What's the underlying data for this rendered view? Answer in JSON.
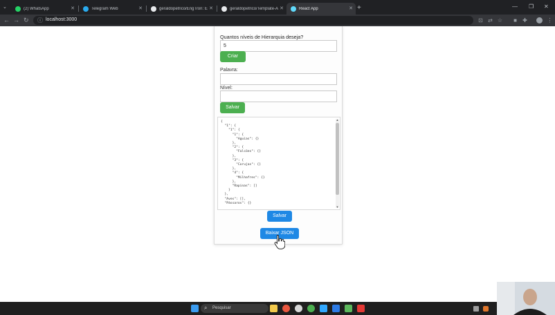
{
  "browser": {
    "tabs": [
      {
        "title": "(2) WhatsApp",
        "icon": "whatsapp-icon",
        "color": "#25d366",
        "active": false
      },
      {
        "title": "Telegram Web",
        "icon": "telegram-icon",
        "color": "#2aabee",
        "active": false
      },
      {
        "title": "geraldopetrico/EngTron: Eurla",
        "icon": "github-icon",
        "color": "#e8eaed",
        "active": false
      },
      {
        "title": "geraldopetrico/Template-Angu",
        "icon": "github-icon",
        "color": "#e8eaed",
        "active": false
      },
      {
        "title": "React App",
        "icon": "react-icon",
        "color": "#61dafb",
        "active": true
      }
    ],
    "new_tab_label": "+",
    "url": "localhost:3000"
  },
  "form": {
    "levels_label": "Quantos níveis de Hierarquia deseja?",
    "levels_value": "5",
    "create_button": "Criar",
    "word_label": "Palavra:",
    "word_value": "",
    "level_label": "Nível:",
    "level_value": "",
    "save_button": "Salvar"
  },
  "json_view": {
    "text": "{\n  \"1\": {\n    \"1\": {\n      \"1\": {\n        \"Aguias\": {}\n      },\n      \"2\": {\n        \"Falcões\": {}\n      },\n      \"3\": {\n        \"Corujas\": {}\n      },\n      \"4\": {\n        \"Milhafres\": {}\n      },\n      \"Rapinas\": []\n    }\n  },\n  \"Aves\": [],\n  \"Pássaros\": {}"
  },
  "actions": {
    "save_button": "Salvar",
    "load_json_button": "Baixar JSON"
  },
  "taskbar": {
    "search_placeholder": "Pesquisar"
  }
}
